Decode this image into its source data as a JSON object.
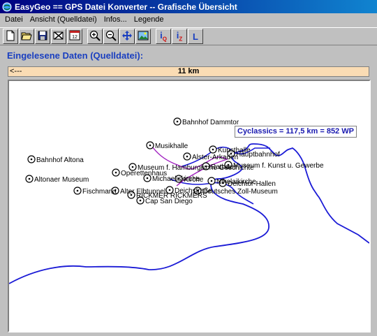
{
  "window": {
    "title": "EasyGeo  ==  GPS Datei Konverter  --  Grafische Übersicht",
    "icon": "globe-icon"
  },
  "menu": [
    "Datei",
    "Ansicht (Quelldatei)",
    "Infos...",
    "Legende"
  ],
  "toolbar": {
    "buttons": [
      "new-icon",
      "open-icon",
      "save-icon",
      "delete-icon",
      "calendar-icon",
      "zoom-in-icon",
      "zoom-out-icon",
      "pan-icon",
      "image-icon"
    ],
    "text_buttons": {
      "iq": "iQ",
      "iz": "iZ",
      "l": "L"
    }
  },
  "section": {
    "heading": "Eingelesene Daten (Quelldatei):"
  },
  "scale": {
    "arrow": "<---",
    "distance": "11 km"
  },
  "route_info": "Cyclassics = 117,5 km = 852 WP",
  "colors": {
    "route": "#1b1bd6",
    "subroute": "#a020c0",
    "heading": "#1a3fc0",
    "scale_bg": "#fadcb4"
  },
  "pois": [
    "Bahnhof Dammtor",
    "Musikhalle",
    "Kunsthalle",
    "Hauptbahnhof",
    "Bahnhof Altona",
    "Alster-Arkaden",
    "Museum f. Hamburgische Geschichte",
    "Rathaus",
    "Museum f. Kunst u. Gewerbe",
    "Operettenhaus",
    "Altonaer Museum",
    "Michaeliskirche",
    "Kirche",
    "Nikolaikirche",
    "Deichtor-Hallen",
    "Fischmarkt",
    "Alter Elbtunnel",
    "Deichstraße",
    "Deutsches Zoll-Museum",
    "RICKMER RICKMERS",
    "Cap San Diego"
  ]
}
